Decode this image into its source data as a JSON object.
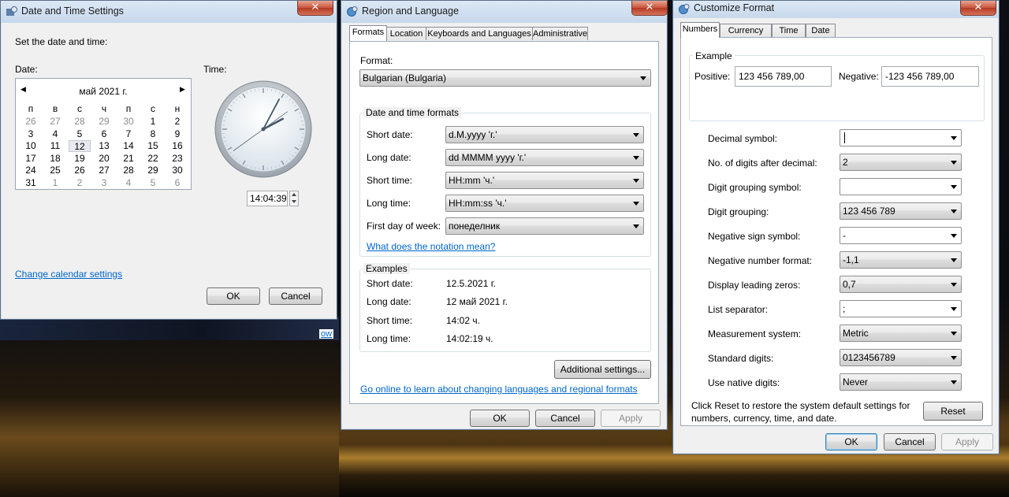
{
  "desktop": {
    "partial_link": "ow"
  },
  "datetime": {
    "title": "Date and Time Settings",
    "heading": "Set the date and time:",
    "date_label": "Date:",
    "time_label": "Time:",
    "month_title": "май 2021 г.",
    "weekdays": [
      "п",
      "в",
      "с",
      "ч",
      "п",
      "с",
      "н"
    ],
    "weeks": [
      [
        "26",
        "27",
        "28",
        "29",
        "30",
        "1",
        "2"
      ],
      [
        "3",
        "4",
        "5",
        "6",
        "7",
        "8",
        "9"
      ],
      [
        "10",
        "11",
        "12",
        "13",
        "14",
        "15",
        "16"
      ],
      [
        "17",
        "18",
        "19",
        "20",
        "21",
        "22",
        "23"
      ],
      [
        "24",
        "25",
        "26",
        "27",
        "28",
        "29",
        "30"
      ],
      [
        "31",
        "1",
        "2",
        "3",
        "4",
        "5",
        "6"
      ]
    ],
    "time_value": "14:04:39",
    "clock": {
      "hour": 14,
      "minute": 4,
      "second": 39
    },
    "change_calendar": "Change calendar settings",
    "ok": "OK",
    "cancel": "Cancel"
  },
  "region": {
    "title": "Region and Language",
    "tabs": [
      "Formats",
      "Location",
      "Keyboards and Languages",
      "Administrative"
    ],
    "format_label": "Format:",
    "format_value": "Bulgarian (Bulgaria)",
    "dt_group": "Date and time formats",
    "rows": [
      {
        "label": "Short date:",
        "value": "d.M.yyyy 'г.'"
      },
      {
        "label": "Long date:",
        "value": "dd MMMM yyyy 'г.'"
      },
      {
        "label": "Short time:",
        "value": "HH:mm 'ч.'"
      },
      {
        "label": "Long time:",
        "value": "HH:mm:ss 'ч.'"
      },
      {
        "label": "First day of week:",
        "value": "понеделник"
      }
    ],
    "notation_link": "What does the notation mean?",
    "examples_group": "Examples",
    "examples": [
      {
        "label": "Short date:",
        "value": "12.5.2021 г."
      },
      {
        "label": "Long date:",
        "value": "12 май 2021 г."
      },
      {
        "label": "Short time:",
        "value": "14:02 ч."
      },
      {
        "label": "Long time:",
        "value": "14:02:19 ч."
      }
    ],
    "additional_settings": "Additional settings...",
    "online_link": "Go online to learn about changing languages and regional formats",
    "ok": "OK",
    "cancel": "Cancel",
    "apply": "Apply"
  },
  "custom": {
    "title": "Customize Format",
    "tabs": [
      "Numbers",
      "Currency",
      "Time",
      "Date"
    ],
    "example_group": "Example",
    "positive_label": "Positive:",
    "positive_value": "123 456 789,00",
    "negative_label": "Negative:",
    "negative_value": "-123 456 789,00",
    "rows": [
      {
        "label": "Decimal symbol:",
        "value": "",
        "white": true
      },
      {
        "label": "No. of digits after decimal:",
        "value": "2",
        "white": false
      },
      {
        "label": "Digit grouping symbol:",
        "value": "",
        "white": true
      },
      {
        "label": "Digit grouping:",
        "value": "123 456 789",
        "white": false
      },
      {
        "label": "Negative sign symbol:",
        "value": "-",
        "white": true
      },
      {
        "label": "Negative number format:",
        "value": "-1,1",
        "white": false
      },
      {
        "label": "Display leading zeros:",
        "value": "0,7",
        "white": false
      },
      {
        "label": "List separator:",
        "value": ";",
        "white": true
      },
      {
        "label": "Measurement system:",
        "value": "Metric",
        "white": false
      },
      {
        "label": "Standard digits:",
        "value": "0123456789",
        "white": false
      },
      {
        "label": "Use native digits:",
        "value": "Never",
        "white": false
      }
    ],
    "reset_note_1": "Click Reset to restore the system default settings for",
    "reset_note_2": "numbers, currency, time, and date.",
    "reset": "Reset",
    "ok": "OK",
    "cancel": "Cancel",
    "apply": "Apply"
  }
}
